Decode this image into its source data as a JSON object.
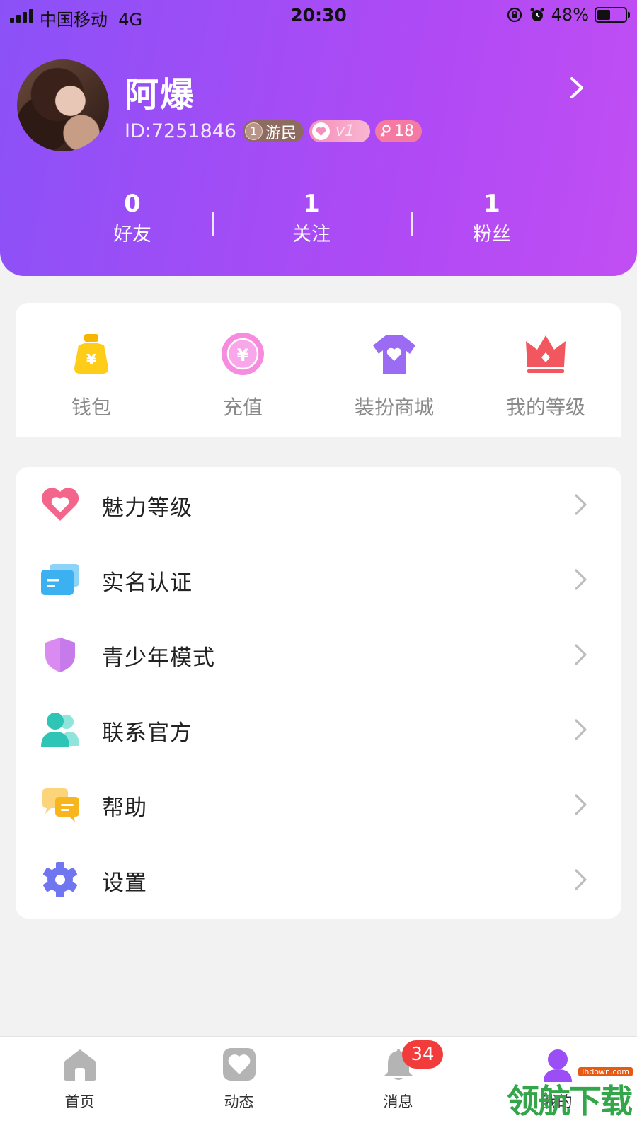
{
  "status_bar": {
    "carrier": "中国移动",
    "network": "4G",
    "time": "20:30",
    "battery_percent": "48%",
    "battery_level": 0.48
  },
  "profile": {
    "name": "阿爆",
    "id": "ID:7251846",
    "badges": {
      "rank_num": "1",
      "rank_label": "游民",
      "vip_label": "v1",
      "age": "18"
    }
  },
  "stats": [
    {
      "value": "0",
      "label": "好友"
    },
    {
      "value": "1",
      "label": "关注"
    },
    {
      "value": "1",
      "label": "粉丝"
    }
  ],
  "quick_actions": [
    {
      "label": "钱包",
      "icon": "wallet-icon"
    },
    {
      "label": "充值",
      "icon": "recharge-icon"
    },
    {
      "label": "装扮商城",
      "icon": "dress-up-store-icon"
    },
    {
      "label": "我的等级",
      "icon": "crown-icon"
    }
  ],
  "menu": [
    {
      "label": "魅力等级",
      "icon": "heart-icon"
    },
    {
      "label": "实名认证",
      "icon": "id-card-icon"
    },
    {
      "label": "青少年模式",
      "icon": "shield-icon"
    },
    {
      "label": "联系官方",
      "icon": "contacts-icon"
    },
    {
      "label": "帮助",
      "icon": "chat-bubbles-icon"
    },
    {
      "label": "设置",
      "icon": "gear-icon"
    }
  ],
  "tabbar": [
    {
      "label": "首页",
      "icon": "home-icon"
    },
    {
      "label": "动态",
      "icon": "moments-icon"
    },
    {
      "label": "消息",
      "icon": "bell-icon",
      "badge": "34"
    },
    {
      "label": "我的",
      "icon": "profile-icon",
      "active": true
    }
  ],
  "watermark": {
    "text": "领航下载",
    "url": "lhdown.com"
  },
  "colors": {
    "header_start": "#8b51f7",
    "header_end": "#c14ef3",
    "active_tab": "#9b4df6",
    "badge_red": "#f23c3c"
  }
}
